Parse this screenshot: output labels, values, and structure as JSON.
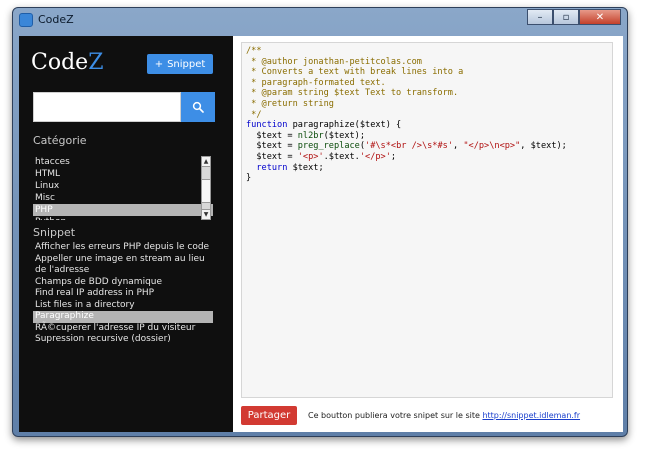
{
  "window": {
    "title": "CodeZ",
    "controls": {
      "minimize": "–",
      "maximize": "▫",
      "close": "✕"
    }
  },
  "sidebar": {
    "logo": {
      "prefix": "Code",
      "suffix": "Z"
    },
    "snippet_button": {
      "icon": "+",
      "label": "Snippet"
    },
    "search": {
      "value": "",
      "placeholder": ""
    },
    "category_title": "Catégorie",
    "categories": [
      "htacces",
      "HTML",
      "Linux",
      "Misc",
      "PHP",
      "Python"
    ],
    "selected_category": "PHP",
    "snippet_title": "Snippet",
    "snippets": [
      "Afficher les erreurs PHP depuis le code",
      "Appeller une image en stream au lieu de l'adresse",
      "Champs de BDD dynamique",
      "Find real IP address in PHP",
      "List files in a directory",
      "Paragraphize",
      "RÃ©cuperer l'adresse IP du visiteur",
      "Supression recursive (dossier)"
    ],
    "selected_snippet": "Paragraphize"
  },
  "code": {
    "lines": [
      "/**",
      " * @author jonathan-petitcolas.com",
      " * Converts a text with break lines into a",
      " * paragraph-formated text.",
      " * @param string $text Text to transform.",
      " * @return string",
      " */",
      "function paragraphize($text) {",
      "  $text = nl2br($text);",
      "  $text = preg_replace('#\\s*<br />\\s*#s', \"</p>\\n<p>\", $text);",
      "  $text = '<p>'.$text.'</p>';",
      "  return $text;",
      "}"
    ]
  },
  "footer": {
    "share_button": "Partager",
    "share_text": "Ce boutton publiera votre snipet sur le site",
    "share_link": "http://snippet.idleman.fr"
  },
  "colors": {
    "accent": "#3d8ee6",
    "danger": "#d23a32",
    "sidebar_bg": "#0f0f0f",
    "selection": "#b4b4b4"
  }
}
